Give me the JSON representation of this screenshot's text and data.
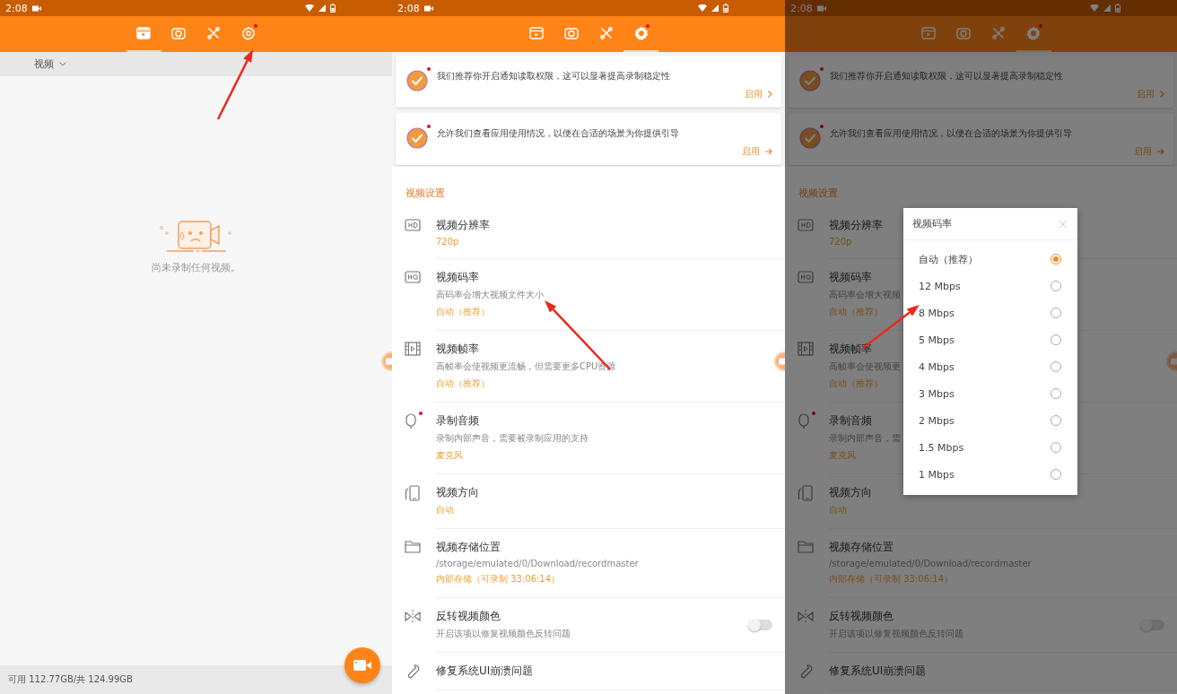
{
  "panels": [
    {
      "kind": "recordings",
      "status_bar": {
        "time": "2:08"
      },
      "tabs": [
        {
          "selected": true
        },
        {
          "selected": false
        },
        {
          "selected": false
        },
        {
          "selected": false,
          "dot": true
        }
      ],
      "filter": {
        "label": "视频"
      },
      "empty_message": "尚未录制任何视频。",
      "storage": "可用 112.77GB/共 124.99GB"
    },
    {
      "kind": "settings",
      "status_bar": {
        "time": "2:08"
      },
      "tabs": [
        {
          "selected": false
        },
        {
          "selected": false
        },
        {
          "selected": false
        },
        {
          "selected": true,
          "dot": true
        }
      ],
      "cards": [
        {
          "text": "我们推荐你开启通知读取权限，这可以显著提高录制稳定性",
          "action": "启用",
          "dot": true
        },
        {
          "text": "允许我们查看应用使用情况，以便在合适的场景为你提供引导",
          "action": "启用",
          "dot": true
        }
      ],
      "section": "视频设置",
      "rows": [
        {
          "title": "视频分辨率",
          "value": "720p"
        },
        {
          "title": "视频码率",
          "description": "高码率会增大视频文件大小",
          "value": "自动（推荐）"
        },
        {
          "title": "视频帧率",
          "description": "高帧率会使视频更流畅，但需要更多CPU资源",
          "value": "自动（推荐）"
        },
        {
          "title": "录制音频",
          "description": "录制内部声音，需要被录制应用的支持",
          "value": "麦克风",
          "dot": true
        },
        {
          "title": "视频方向",
          "value": "自动"
        },
        {
          "title": "视频存储位置",
          "description": "/storage/emulated/0/Download/recordmaster",
          "value": "内部存储（可录制 33:06:14）"
        },
        {
          "title": "反转视频颜色",
          "description": "开启该项以修复视频颜色反转问题",
          "toggle": {
            "on": false
          }
        },
        {
          "title": "修复系统UI崩溃问题"
        }
      ]
    },
    {
      "kind": "settings",
      "dimmed": true,
      "status_bar": {
        "time": "2:08"
      },
      "tabs": [
        {
          "selected": false
        },
        {
          "selected": false
        },
        {
          "selected": false
        },
        {
          "selected": true,
          "dot": true
        }
      ],
      "cards": [
        {
          "text": "我们推荐你开启通知读取权限，这可以显著提高录制稳定性",
          "action": "启用",
          "dot": true
        },
        {
          "text": "允许我们查看应用使用情况，以便在合适的场景为你提供引导",
          "action": "启用",
          "dot": true
        }
      ],
      "section": "视频设置",
      "rows": [
        {
          "title": "视频分辨率",
          "value": "720p"
        },
        {
          "title": "视频码率",
          "description": "高码率会增大视频",
          "value": "自动（推荐）"
        },
        {
          "title": "视频帧率",
          "description": "高帧率会使视频更",
          "value": "自动（推荐）"
        },
        {
          "title": "录制音频",
          "description": "录制内部声音，需",
          "value": "麦克风",
          "dot": true
        },
        {
          "title": "视频方向",
          "value": "自动"
        },
        {
          "title": "视频存储位置",
          "description": "/storage/emulated/0/Download/recordmaster",
          "value": "内部存储（可录制 33:06:14）"
        },
        {
          "title": "反转视频颜色",
          "description": "开启该项以修复视频颜色反转问题",
          "toggle": {
            "on": false
          }
        },
        {
          "title": "修复系统UI崩溃问题"
        }
      ],
      "dialog": {
        "title": "视频码率",
        "options": [
          {
            "label": "自动（推荐）",
            "selected": true
          },
          {
            "label": "12 Mbps",
            "selected": false
          },
          {
            "label": "8 Mbps",
            "selected": false
          },
          {
            "label": "5 Mbps",
            "selected": false
          },
          {
            "label": "4 Mbps",
            "selected": false
          },
          {
            "label": "3 Mbps",
            "selected": false
          },
          {
            "label": "2 Mbps",
            "selected": false
          },
          {
            "label": "1.5 Mbps",
            "selected": false
          },
          {
            "label": "1 Mbps",
            "selected": false
          }
        ]
      }
    }
  ]
}
